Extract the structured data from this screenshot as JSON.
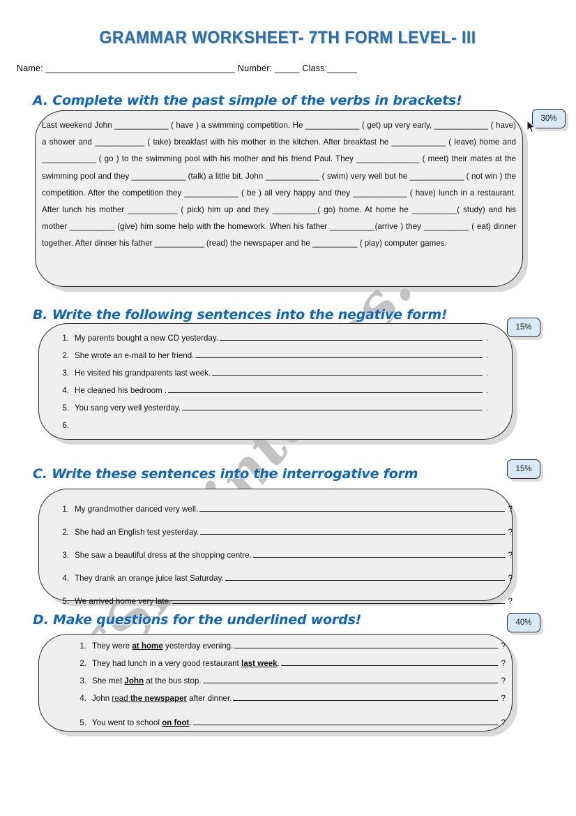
{
  "document": {
    "title": "GRAMMAR WORKSHEET- 7TH FORM LEVEL- III",
    "name_line": "Name: ______________________________________ Number: _____ Class:______",
    "watermark": "ESLprintables.com"
  },
  "sections": {
    "a": {
      "heading": "A. Complete with the past simple of the verbs in brackets!",
      "badge": "30%",
      "paragraph": "Last weekend John  ____________  ( have )  a swimming competition. He ____________  ( get) up very early,  ____________  ( have)   a  shower  and  ___________   ( take)  breakfast  with  his  mother   in  the  kitchen.    After  breakfast  he  ____________   ( leave)  home  and  ____________   ( go )  to  the  swimming  pool  with  his  mother  and  his  friend  Paul.  They  ______________    ( meet)  their  mates  at  the  swimming  pool  and  they  ____________   (talk)  a  little  bit.  John  ____________  ( swim)  very  well  but  he  ____________   ( not win )  the  competition.    After  the  competition  they  ____________  ( be )  all very happy  and   they  ____________   ( have)  lunch  in  a  restaurant.    After    lunch   his   mother   ___________    (  pick)   him   up   and   they   __________( go)   home.   At   home   he  __________( study)  and  his  mother  __________  (give)  him  some  help  with  the  homework.   When  his  father  __________(arrive )  they  __________   ( eat)  dinner  together.   After  dinner  his  father  ___________  (read)  the  newspaper  and  he  __________  ( play)  computer  games."
    },
    "b": {
      "heading": "B. Write the following sentences into the negative form!",
      "badge": "15%",
      "items": [
        {
          "num": "1.",
          "text": "My parents bought a new CD yesterday.",
          "end": "."
        },
        {
          "num": "2.",
          "text": "She wrote an e-mail to her friend.",
          "end": "."
        },
        {
          "num": "3.",
          "text": "He  visited his grandparents last week.",
          "end": "."
        },
        {
          "num": "4.",
          "text": "He cleaned his bedroom .",
          "end": "."
        },
        {
          "num": "5.",
          "text": "You sang very well yesterday.",
          "end": "."
        },
        {
          "num": "6.",
          "text": "",
          "end": ""
        }
      ]
    },
    "c": {
      "heading": "C. Write these sentences into the interrogative form",
      "badge": "15%",
      "items": [
        {
          "num": "1.",
          "text": "My grandmother danced very well.",
          "end": "?"
        },
        {
          "num": "2.",
          "text": "She  had an English test yesterday.",
          "end": "?"
        },
        {
          "num": "3.",
          "text": "She saw a beautiful dress at the shopping centre.",
          "end": "?"
        },
        {
          "num": "4.",
          "text": "They  drank an orange juice last Saturday.",
          "end": "?"
        },
        {
          "num": "5.",
          "text": "We arrived home very late.",
          "end": "?"
        }
      ]
    },
    "d": {
      "heading": "D. Make questions for the underlined words!",
      "badge": "40%",
      "items": [
        {
          "num": "1.",
          "pre": "They were ",
          "mark": "at home",
          "post": "  yesterday evening.",
          "end": "?"
        },
        {
          "num": "2.",
          "pre": "They had lunch  in a very good restaurant ",
          "mark": "last week",
          "post": ".",
          "end": "?"
        },
        {
          "num": "3.",
          "pre": "She met ",
          "mark": "John",
          "post": " at the bus stop.",
          "end": "?"
        },
        {
          "num": "4.",
          "pre": "John ",
          "mark_plain": "read",
          "mark": "the newspaper",
          "post": " after dinner.",
          "end": "?"
        },
        {
          "num": "5.",
          "pre": "You went to school ",
          "mark": "on foot",
          "post": ".",
          "end": "?"
        }
      ]
    }
  }
}
